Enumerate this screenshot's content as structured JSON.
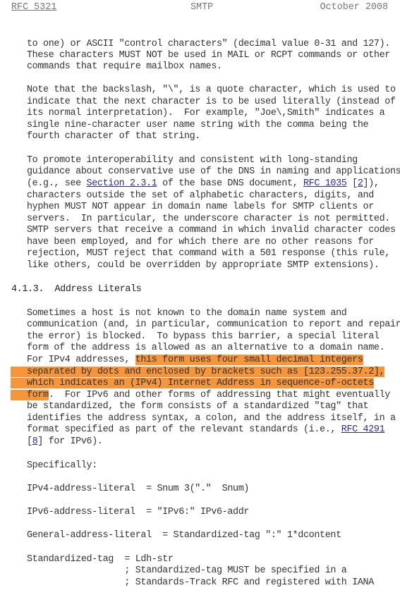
{
  "header": {
    "left": "RFC 5321",
    "center": "SMTP",
    "right": "October 2008"
  },
  "paragraphs": {
    "p1": [
      "to one) or ASCII \"control characters\" (decimal value 0-31 and 127).",
      "These characters MUST NOT be used in MAIL or RCPT commands or other",
      "commands that require mailbox names."
    ],
    "p2": [
      "Note that the backslash, \"\\\", is a quote character, which is used to",
      "indicate that the next character is to be used literally (instead of",
      "its normal interpretation).  For example, \"Joe\\,Smith\" indicates a",
      "single nine-character user name string with the comma being the",
      "fourth character of that string."
    ],
    "p3": {
      "l1": "To promote interoperability and consistent with long-standing",
      "l2": "guidance about conservative use of the DNS in naming and applications",
      "l3a": "(e.g., see ",
      "l3_link1": "Section 2.3.1",
      "l3b": " of the base DNS document, ",
      "l3_link2": "RFC 1035",
      "l3c": " [",
      "l3_link3": "2",
      "l3d": "]),",
      "rest": [
        "characters outside the set of alphabetic characters, digits, and",
        "hyphen MUST NOT appear in domain name labels for SMTP clients or",
        "servers.  In particular, the underscore character is not permitted.",
        "SMTP servers that receive a command in which invalid character codes",
        "have been employed, and for which there are no other reasons for",
        "rejection, MUST reject that command with a 501 response (this rule,",
        "like others, could be overridden by appropriate SMTP extensions)."
      ]
    },
    "section_heading": "4.1.3.  Address Literals",
    "p4": {
      "lines": [
        "Sometimes a host is not known to the domain name system and",
        "communication (and, in particular, communication to report and repair",
        "the error) is blocked.  To bypass this barrier, a special literal",
        "form of the address is allowed as an alternative to a domain name."
      ],
      "l5a": "For IPv4 addresses, ",
      "l5_hl": "this form uses four small decimal integers",
      "l6_hl": "separated by dots and enclosed by brackets such as [123.255.37.2],",
      "l7_hl": "which indicates an (IPv4) Internet Address in sequence-of-octets",
      "l8_hl": "form",
      "l8b": ".  For IPv6 and other forms of addressing that might eventually",
      "more": [
        "be standardized, the form consists of a standardized \"tag\" that",
        "identifies the address syntax, a colon, and the address itself, in a"
      ],
      "l11a": "format specified as part of the relevant standards (i.e., ",
      "l11_link": "RFC 4291",
      "l12a": "[",
      "l12_link": "8",
      "l12b": "] for IPv6)."
    },
    "specifically": "Specifically:",
    "grammar": [
      "IPv4-address-literal  = Snum 3(\".\"  Snum)",
      "IPv6-address-literal  = \"IPv6:\" IPv6-addr",
      "General-address-literal  = Standardized-tag \":\" 1*dcontent",
      "Standardized-tag  = Ldh-str",
      "                  ; Standardized-tag MUST be specified in a",
      "                  ; Standards-Track RFC and registered with IANA"
    ]
  },
  "colors": {
    "highlight": "#f7953a",
    "link": "#2a2a8f",
    "text": "#333333"
  }
}
